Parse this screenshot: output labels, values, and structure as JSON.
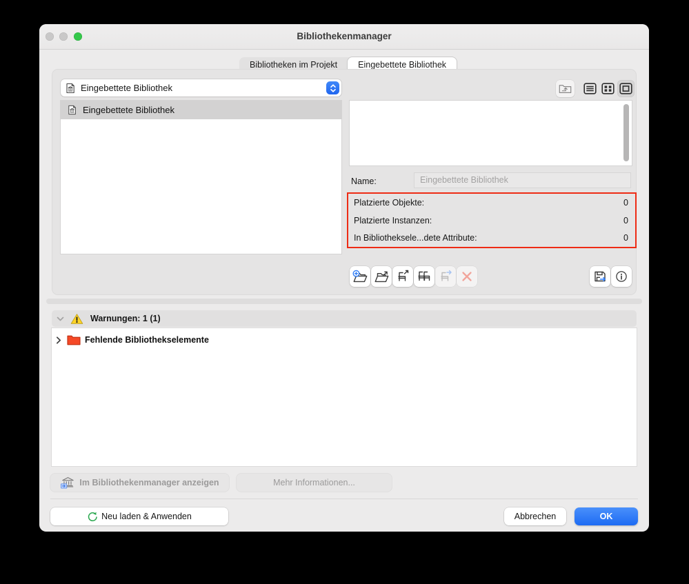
{
  "window": {
    "title": "Bibliothekenmanager"
  },
  "tabs": [
    {
      "label": "Bibliotheken im Projekt",
      "selected": false
    },
    {
      "label": "Eingebettete Bibliothek",
      "selected": true
    }
  ],
  "library_selector": {
    "value": "Eingebettete Bibliothek"
  },
  "library_list": {
    "items": [
      {
        "label": "Eingebettete Bibliothek",
        "selected": true
      }
    ]
  },
  "details": {
    "name_label": "Name:",
    "name_value": "Eingebettete Bibliothek",
    "stats": [
      {
        "label": "Platzierte Objekte:",
        "value": "0"
      },
      {
        "label": "Platzierte Instanzen:",
        "value": "0"
      },
      {
        "label": "In Bibliotheksele...dete Attribute:",
        "value": "0"
      }
    ]
  },
  "warnings": {
    "header": "Warnungen: 1 (1)",
    "items": [
      {
        "label": "Fehlende Bibliothekselemente"
      }
    ]
  },
  "buttons": {
    "show_in_manager": "Im Bibliothekenmanager anzeigen",
    "more_info": "Mehr Informationen...",
    "reload_apply": "Neu laden & Anwenden",
    "cancel": "Abbrechen",
    "ok": "OK"
  },
  "icons": {
    "traffic_lights": [
      "window-close",
      "window-minimize",
      "window-zoom"
    ],
    "library_selector": "library-file-icon",
    "view_modes": [
      "folder-up-icon",
      "list-view-icon",
      "grid-view-icon",
      "icon-view-icon"
    ],
    "toolbar": [
      "add-library-icon",
      "open-library-icon",
      "import-object-icon",
      "duplicate-objects-icon",
      "export-object-icon",
      "delete-icon",
      "save-as-icon",
      "info-icon"
    ],
    "warning": "warning-triangle-icon",
    "missing_folder": "red-folder-icon",
    "reload": "refresh-icon"
  },
  "colors": {
    "accent_blue": "#2E7CF6",
    "ok_blue": "#1D6BF3",
    "highlight_red": "#EE2B14",
    "warning_yellow": "#FFD426",
    "folder_red": "#F54927",
    "refresh_green": "#2AA84F"
  }
}
